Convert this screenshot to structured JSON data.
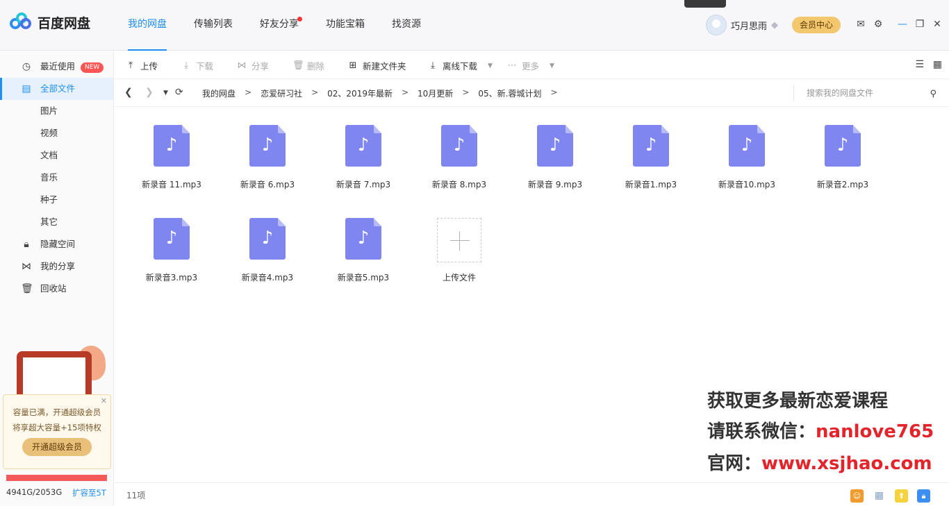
{
  "app": {
    "name": "百度网盘",
    "accent": "#1f8ef2"
  },
  "nav": {
    "tabs": [
      "我的网盘",
      "传输列表",
      "好友分享",
      "功能宝箱",
      "找资源"
    ],
    "active": "我的网盘"
  },
  "user": {
    "name": "巧月思雨",
    "vip_button": "会员中心"
  },
  "sidebar": {
    "items": [
      {
        "label": "最近使用",
        "badge": "NEW"
      },
      {
        "label": "全部文件"
      },
      {
        "label": "图片"
      },
      {
        "label": "视频"
      },
      {
        "label": "文档"
      },
      {
        "label": "音乐"
      },
      {
        "label": "种子"
      },
      {
        "label": "其它"
      },
      {
        "label": "隐藏空间"
      },
      {
        "label": "我的分享"
      },
      {
        "label": "回收站"
      }
    ],
    "promo_line1": "容量已满，开通超级会员",
    "promo_line2": "将享超大容量+15项特权",
    "promo_button": "开通超级会员",
    "storage": "4941G/2053G",
    "expand": "扩容至5T"
  },
  "toolbar": {
    "upload": "上传",
    "download": "下载",
    "share": "分享",
    "delete": "删除",
    "new_folder": "新建文件夹",
    "offline": "离线下载",
    "more": "更多"
  },
  "path": {
    "crumbs": [
      "我的网盘",
      "恋爱研习社",
      "02、2019年最新",
      "10月更新",
      "05、新.蓉城计划"
    ],
    "separator": ">",
    "search_placeholder": "搜索我的网盘文件"
  },
  "files": [
    "新录音 11.mp3",
    "新录音 6.mp3",
    "新录音 7.mp3",
    "新录音 8.mp3",
    "新录音 9.mp3",
    "新录音1.mp3",
    "新录音10.mp3",
    "新录音2.mp3",
    "新录音3.mp3",
    "新录音4.mp3",
    "新录音5.mp3"
  ],
  "upload_tile": "上传文件",
  "watermark": {
    "line1": "获取更多最新恋爱课程",
    "line2_prefix": "请联系微信：",
    "line2_value": "nanlove765",
    "line3_prefix": "官网：",
    "line3_value": "www.xsjhao.com"
  },
  "status": {
    "count": "11项"
  }
}
